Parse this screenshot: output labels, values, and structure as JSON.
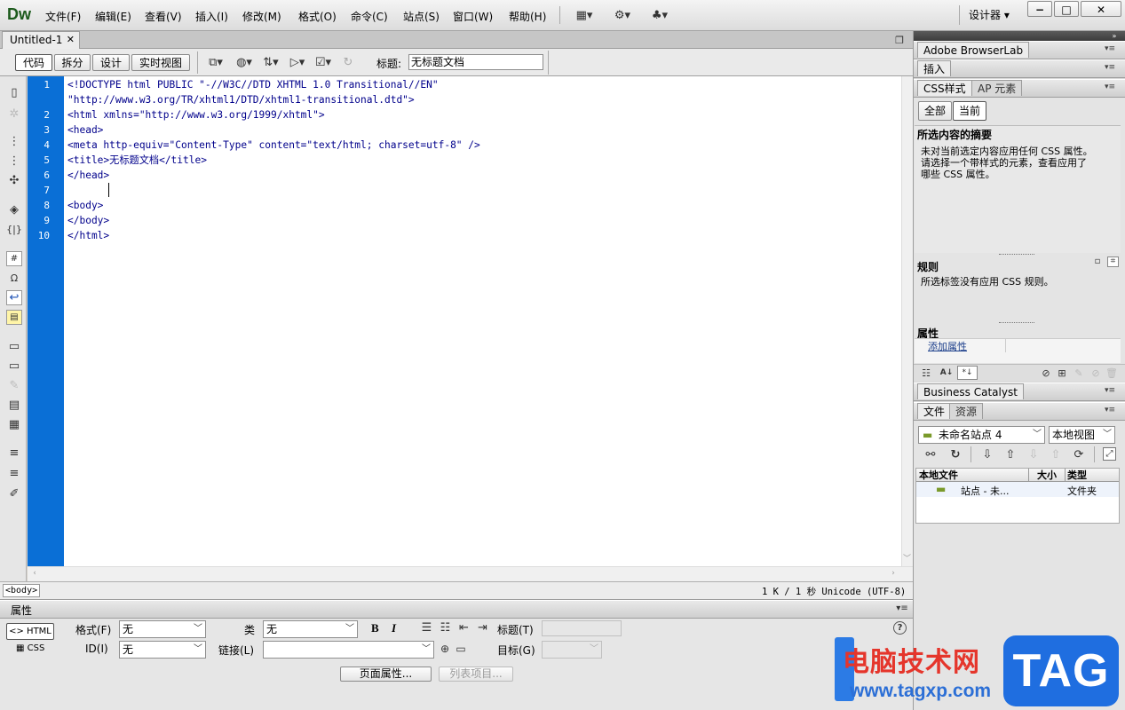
{
  "app": {
    "logo": "Dw",
    "workspace": "设计器"
  },
  "menu": [
    "文件(F)",
    "编辑(E)",
    "查看(V)",
    "插入(I)",
    "修改(M)",
    "格式(O)",
    "命令(C)",
    "站点(S)",
    "窗口(W)",
    "帮助(H)"
  ],
  "document": {
    "tab": "Untitled-1",
    "title_label": "标题:",
    "title_value": "无标题文档"
  },
  "views": [
    "代码",
    "拆分",
    "设计",
    "实时视图"
  ],
  "code": {
    "line_numbers": [
      "1",
      "",
      "2",
      "3",
      "4",
      "5",
      "6",
      "7",
      "8",
      "9",
      "10"
    ],
    "lines": [
      "<!DOCTYPE html PUBLIC \"-//W3C//DTD XHTML 1.0 Transitional//EN\"",
      "\"http://www.w3.org/TR/xhtml1/DTD/xhtml1-transitional.dtd\">",
      "<html xmlns=\"http://www.w3.org/1999/xhtml\">",
      "<head>",
      "<meta http-equiv=\"Content-Type\" content=\"text/html; charset=utf-8\" />",
      "<title>无标题文档</title>",
      "</head>",
      "",
      "<body>",
      "</body>",
      "</html>"
    ]
  },
  "status": {
    "tag": "<body>",
    "info": "1 K / 1 秒 Unicode (UTF-8)"
  },
  "properties": {
    "panel_title": "属性",
    "html_btn": "HTML",
    "css_btn": "CSS",
    "format_label": "格式(F)",
    "format_value": "无",
    "class_label": "类",
    "class_value": "无",
    "bold": "B",
    "italic": "I",
    "title_label": "标题(T)",
    "id_label": "ID(I)",
    "id_value": "无",
    "link_label": "链接(L)",
    "link_value": "",
    "target_label": "目标(G)",
    "page_props": "页面属性...",
    "list_items": "列表项目..."
  },
  "right": {
    "browserlab": "Adobe BrowserLab",
    "insert": "插入",
    "css_tab": "CSS样式",
    "ap_tab": "AP 元素",
    "all": "全部",
    "current": "当前",
    "summary_title": "所选内容的摘要",
    "summary_text_1": "未对当前选定内容应用任何 CSS 属性。",
    "summary_text_2": "请选择一个带样式的元素，查看应用了",
    "summary_text_3": "哪些 CSS 属性。",
    "rules_title": "规则",
    "rules_text": "所选标签没有应用 CSS 规则。",
    "attr_title": "属性",
    "add_attr": "添加属性",
    "bc": "Business Catalyst",
    "files_tab": "文件",
    "assets_tab": "资源",
    "site": "未命名站点 4",
    "view": "本地视图",
    "col_local": "本地文件",
    "col_size": "大小",
    "col_type": "类型",
    "row_name": "站点 - 未...",
    "row_type": "文件夹"
  },
  "watermark": {
    "site_name": "电脑技术网",
    "url": "www.tagxp.com",
    "tag": "TAG"
  },
  "colors": {
    "gutter": "#0a6fd6",
    "code_text": "#00008b"
  }
}
